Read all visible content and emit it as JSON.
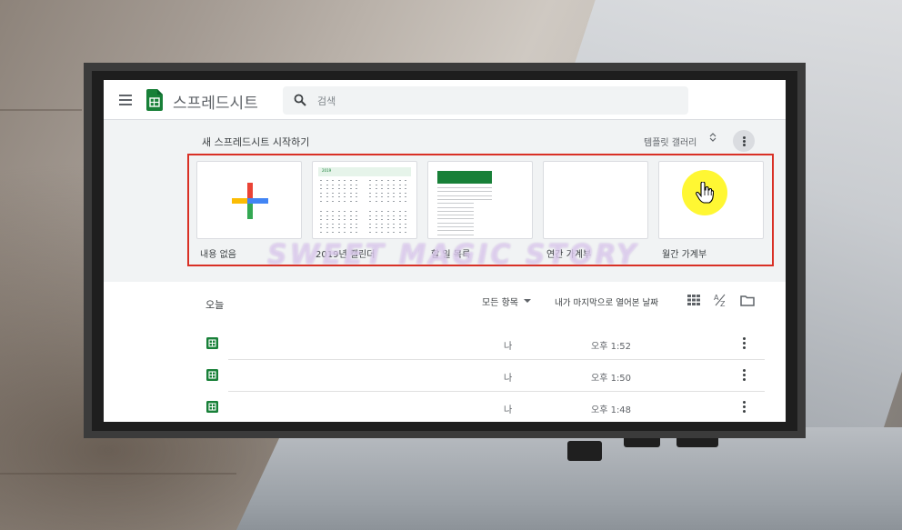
{
  "app": {
    "title": "스프레드시트"
  },
  "search": {
    "placeholder": "검색"
  },
  "templates": {
    "heading": "새 스프레드시트 시작하기",
    "gallery_label": "템플릿 갤러리",
    "items": [
      {
        "label": "내용 없음",
        "preview": "plus-icon"
      },
      {
        "label": "2019년 캘린더",
        "preview": "calendar",
        "preview_title": "2019"
      },
      {
        "label": "할 일 목록",
        "preview": "todo-list"
      },
      {
        "label": "연간 가계부",
        "preview": "blank"
      },
      {
        "label": "월간 가계부",
        "preview": "blank"
      }
    ]
  },
  "watermark": {
    "text": "SWEET MAGIC STORY"
  },
  "files": {
    "section_label": "오늘",
    "owner_filter": "모든 항목",
    "sort_label": "내가 마지막으로 열어본 날짜",
    "rows": [
      {
        "name": "",
        "owner": "나",
        "time": "오후 1:52"
      },
      {
        "name": "",
        "owner": "나",
        "time": "오후 1:50"
      },
      {
        "name": "",
        "owner": "나",
        "time": "오후 1:48"
      }
    ]
  },
  "colors": {
    "sheets_green": "#188038",
    "highlight_red": "#d93025",
    "cursor_yellow": "#fff500",
    "plus_blue": "#4285f4",
    "plus_red": "#ea4335",
    "plus_yellow": "#fbbc04",
    "plus_green": "#34a853"
  }
}
